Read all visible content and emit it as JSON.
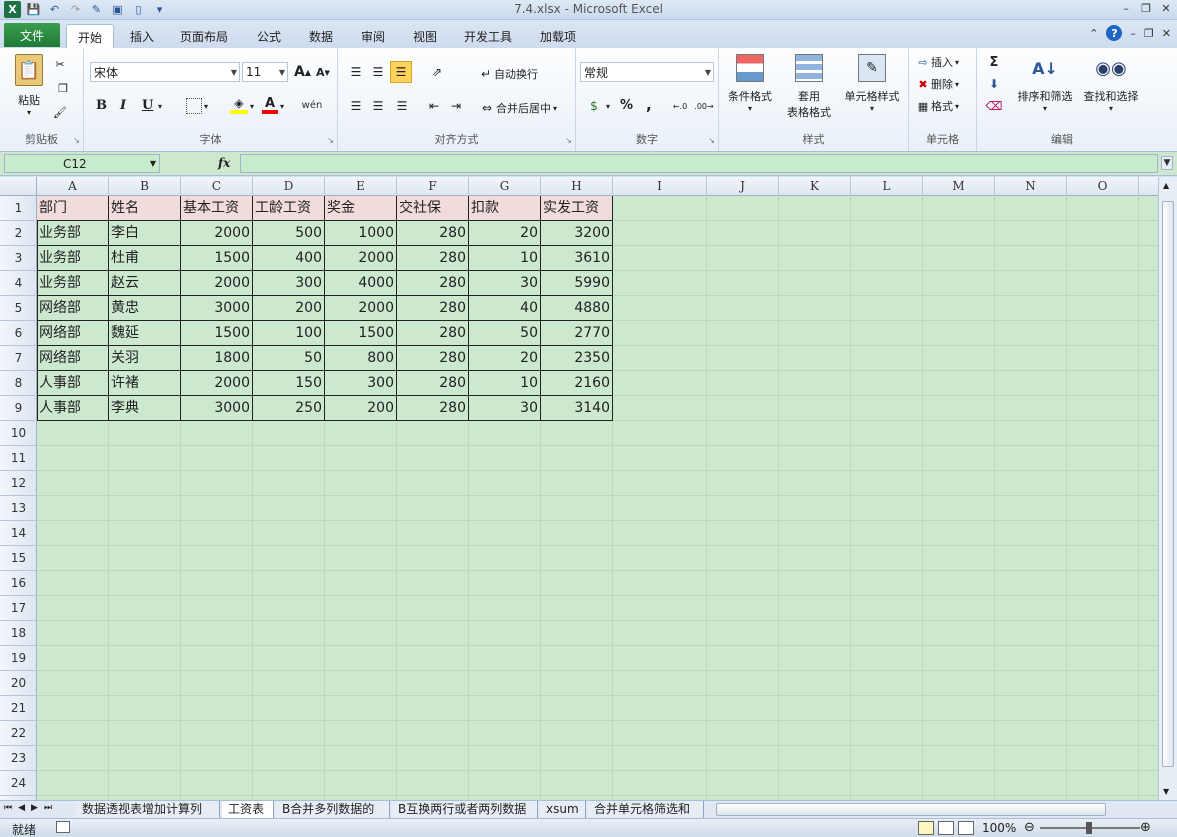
{
  "window": {
    "title": "7.4.xlsx  -  Microsoft Excel"
  },
  "ribbon_tabs": {
    "file": "文件",
    "items": [
      "开始",
      "插入",
      "页面布局",
      "公式",
      "数据",
      "审阅",
      "视图",
      "开发工具",
      "加载项"
    ],
    "active": "开始"
  },
  "ribbon": {
    "clipboard": {
      "label": "剪贴板",
      "paste": "粘贴"
    },
    "font": {
      "label": "字体",
      "font_name": "宋体",
      "font_size": "11",
      "bold": "B",
      "italic": "I",
      "underline": "U"
    },
    "alignment": {
      "label": "对齐方式",
      "wrap": "自动换行",
      "merge": "合并后居中"
    },
    "number": {
      "label": "数字",
      "format": "常规",
      "percent": "%",
      "comma": ","
    },
    "styles": {
      "label": "样式",
      "conditional": "条件格式",
      "table_line1": "套用",
      "table_line2": "表格格式",
      "cell_styles": "单元格样式"
    },
    "cells": {
      "label": "单元格",
      "insert": "插入",
      "delete": "删除",
      "format": "格式"
    },
    "editing": {
      "label": "编辑",
      "sort": "排序和筛选",
      "find": "查找和选择"
    }
  },
  "formula_bar": {
    "name_box": "C12",
    "fx": "fx",
    "value": ""
  },
  "columns": [
    "A",
    "B",
    "C",
    "D",
    "E",
    "F",
    "G",
    "H",
    "I",
    "J",
    "K",
    "L",
    "M",
    "N",
    "O"
  ],
  "rows": [
    "1",
    "2",
    "3",
    "4",
    "5",
    "6",
    "7",
    "8",
    "9",
    "10",
    "11",
    "12",
    "13",
    "14",
    "15",
    "16",
    "17",
    "18",
    "19",
    "20",
    "21",
    "22",
    "23",
    "24"
  ],
  "table": {
    "headers": [
      "部门",
      "姓名",
      "基本工资",
      "工龄工资",
      "奖金",
      "交社保",
      "扣款",
      "实发工资"
    ],
    "rows": [
      [
        "业务部",
        "李白",
        "2000",
        "500",
        "1000",
        "280",
        "20",
        "3200"
      ],
      [
        "业务部",
        "杜甫",
        "1500",
        "400",
        "2000",
        "280",
        "10",
        "3610"
      ],
      [
        "业务部",
        "赵云",
        "2000",
        "300",
        "4000",
        "280",
        "30",
        "5990"
      ],
      [
        "网络部",
        "黄忠",
        "3000",
        "200",
        "2000",
        "280",
        "40",
        "4880"
      ],
      [
        "网络部",
        "魏延",
        "1500",
        "100",
        "1500",
        "280",
        "50",
        "2770"
      ],
      [
        "网络部",
        "关羽",
        "1800",
        "50",
        "800",
        "280",
        "20",
        "2350"
      ],
      [
        "人事部",
        "许褚",
        "2000",
        "150",
        "300",
        "280",
        "10",
        "2160"
      ],
      [
        "人事部",
        "李典",
        "3000",
        "250",
        "200",
        "280",
        "30",
        "3140"
      ]
    ]
  },
  "sheet_tabs": [
    "数据透视表增加计算列",
    "工资表",
    "B合并多列数据的",
    "B互换两行或者两列数据",
    "xsum",
    "合并单元格筛选和"
  ],
  "active_sheet": "工资表",
  "status": {
    "ready": "就绪",
    "zoom": "100%"
  }
}
